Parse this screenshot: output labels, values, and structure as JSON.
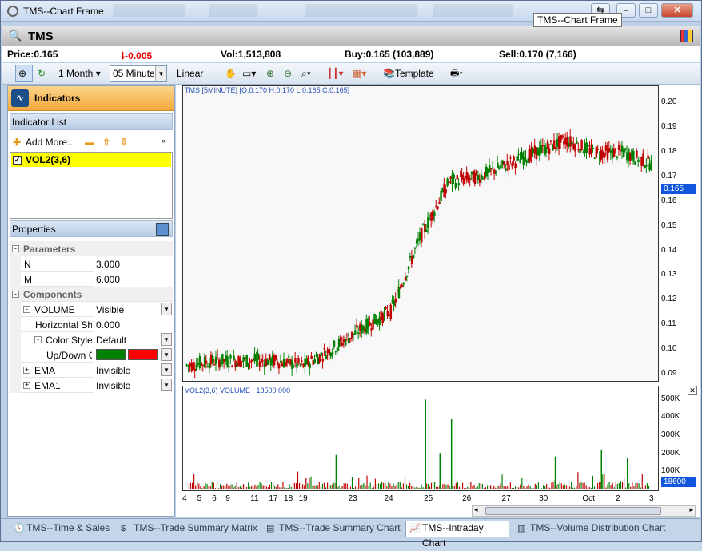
{
  "window": {
    "title": "TMS--Chart Frame",
    "tooltip": "TMS--Chart Frame"
  },
  "symbol": {
    "name": "TMS"
  },
  "quote": {
    "price": "Price:0.165",
    "change": "-0.005",
    "volume": "Vol:1,513,808",
    "buy": "Buy:0.165 (103,889)",
    "sell": "Sell:0.170 (7,166)"
  },
  "toolbar": {
    "period": "1 Month",
    "interval": "05 Minute",
    "scale": "Linear",
    "template": "Template"
  },
  "left_panel": {
    "indicators_title": "Indicators",
    "indicator_list_title": "Indicator List",
    "add_more": "Add More...",
    "indicators": [
      {
        "label": "VOL2(3,6)",
        "checked": true
      }
    ],
    "properties_title": "Properties",
    "properties": [
      {
        "name": "Parameters",
        "value": "",
        "category": true,
        "expander": "-"
      },
      {
        "name": "N",
        "value": "3.000"
      },
      {
        "name": "M",
        "value": "6.000"
      },
      {
        "name": "Components",
        "value": "",
        "category": true,
        "expander": "-"
      },
      {
        "name": "VOLUME",
        "value": "Visible",
        "category": true,
        "expander": "-",
        "dropdown": true
      },
      {
        "name": "Horizontal Sh",
        "value": "0.000"
      },
      {
        "name": "Color Style",
        "value": "Default",
        "expander": "-",
        "dropdown": true
      },
      {
        "name": "Up/Down C",
        "value": "",
        "swatches": [
          "#008000",
          "#ff0000"
        ],
        "dropdown": true
      },
      {
        "name": "EMA",
        "value": "Invisible",
        "category": true,
        "expander": "+",
        "dropdown": true
      },
      {
        "name": "EMA1",
        "value": "Invisible",
        "category": true,
        "expander": "+",
        "dropdown": true
      }
    ]
  },
  "chart_data": [
    {
      "type": "line",
      "title": "TMS [5MINUTE] [O:0.170 H:0.170 L:0.165 C:0.165]",
      "y_ticks": [
        "0.20",
        "0.19",
        "0.18",
        "0.17",
        "0.16",
        "0.15",
        "0.14",
        "0.13",
        "0.12",
        "0.11",
        "0.10",
        "0.09"
      ],
      "ylim": [
        0.088,
        0.205
      ],
      "last_price_tag": "0.165",
      "x_ticks": [
        "4",
        "5",
        "6",
        "9",
        "11",
        "17",
        "18",
        "19",
        "23",
        "24",
        "25",
        "26",
        "27",
        "30",
        "Oct",
        "2",
        "3"
      ],
      "x": [
        0,
        1,
        2,
        3,
        4,
        5,
        6,
        7,
        8,
        9,
        10,
        11,
        12,
        13,
        14,
        15,
        16
      ],
      "series": [
        {
          "values": [
            0.093,
            0.095,
            0.095,
            0.095,
            0.093,
            0.1,
            0.108,
            0.115,
            0.145,
            0.168,
            0.17,
            0.175,
            0.18,
            0.185,
            0.18,
            0.18,
            0.175
          ]
        }
      ],
      "up_color": "#008000",
      "down_color": "#c00000"
    },
    {
      "type": "bar",
      "title": "VOL2(3,6)  VOLUME : 18500.000",
      "y_ticks": [
        "500K",
        "400K",
        "300K",
        "200K",
        "100K"
      ],
      "ylim": [
        0,
        520000
      ],
      "last_value_tag": "18600",
      "peaks": [
        {
          "x": 8.2,
          "value": 500000
        },
        {
          "x": 9.1,
          "value": 390000
        },
        {
          "x": 8.7,
          "value": 200000
        },
        {
          "x": 5.1,
          "value": 190000
        },
        {
          "x": 14.3,
          "value": 220000
        },
        {
          "x": 12.7,
          "value": 180000
        },
        {
          "x": 15.2,
          "value": 170000
        }
      ]
    }
  ],
  "tabs": [
    {
      "label": "TMS--Time & Sales",
      "active": false
    },
    {
      "label": "TMS--Trade Summary Matrix",
      "active": false
    },
    {
      "label": "TMS--Trade Summary Chart",
      "active": false
    },
    {
      "label": "TMS--Intraday Chart",
      "active": true
    },
    {
      "label": "TMS--Volume Distribution Chart",
      "active": false
    }
  ],
  "colors": {
    "accent_tag": "#1155dd",
    "indicator_highlight": "#ffff00",
    "change_down": "#e00000"
  }
}
